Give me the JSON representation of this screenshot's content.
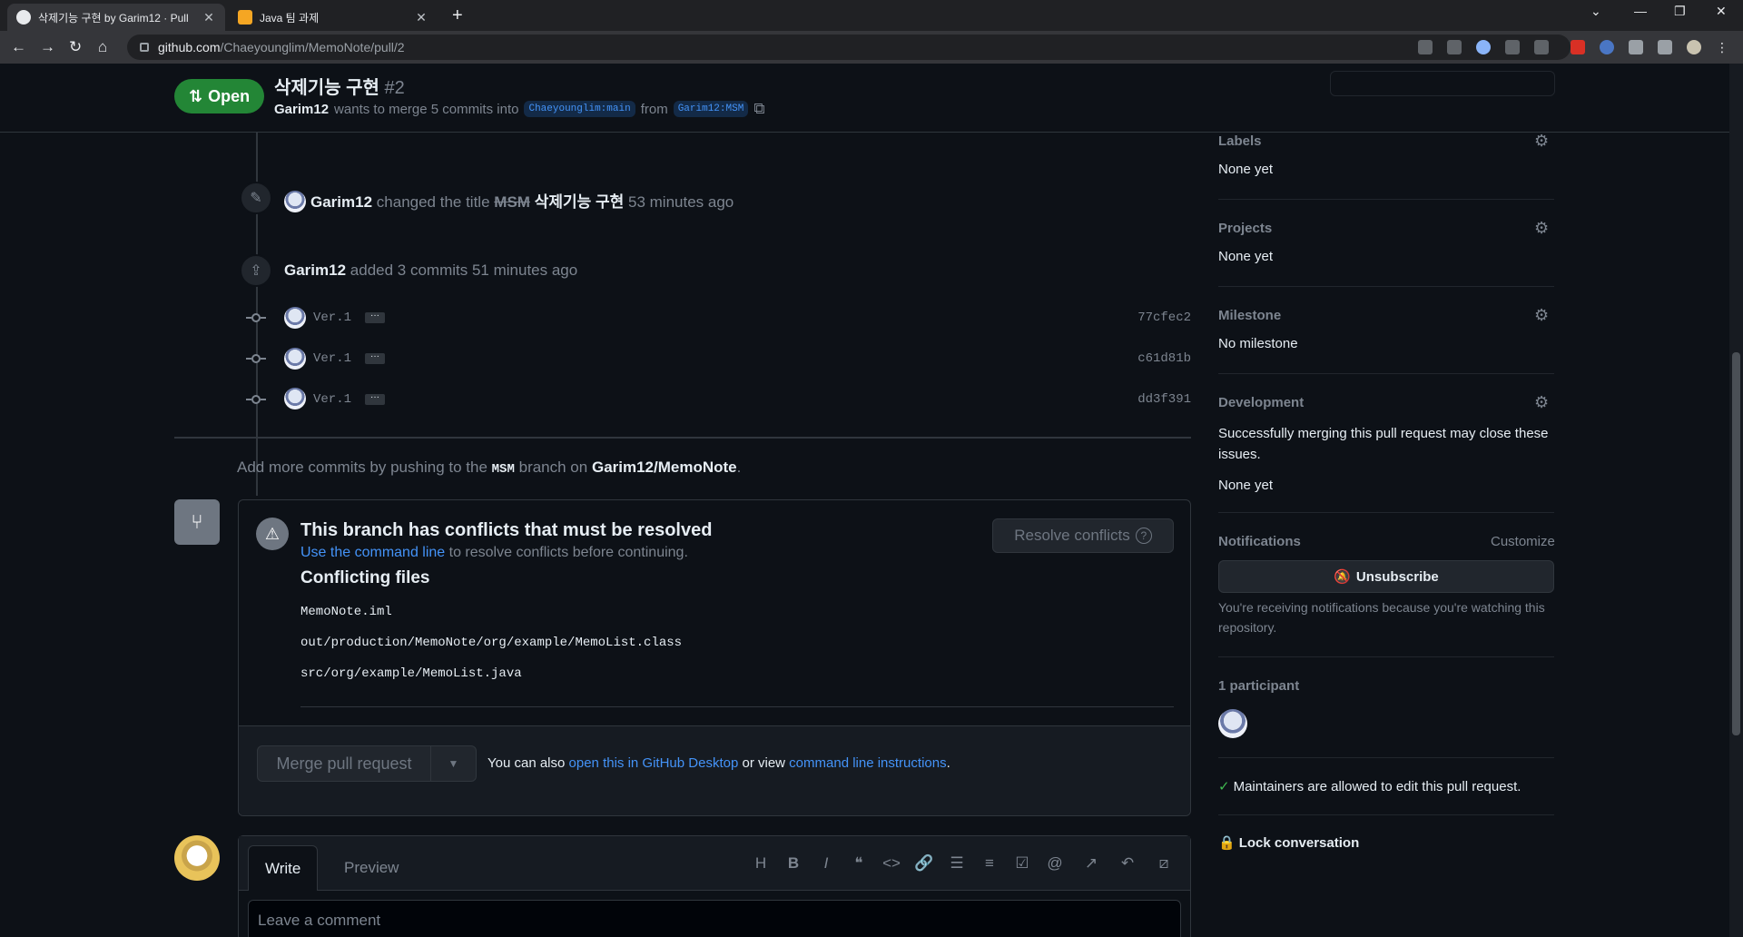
{
  "browser": {
    "tabs": [
      {
        "label": "삭제기능 구현 by Garim12 · Pull"
      },
      {
        "label": "Java 팀 과제"
      }
    ],
    "url_host": "github.com",
    "url_path": "/Chaeyounglim/MemoNote/pull/2"
  },
  "pr": {
    "state": "Open",
    "title": "삭제기능 구현",
    "number": "#2",
    "author": "Garim12",
    "merge_text": "wants to merge 5 commits into",
    "base_branch": "Chaeyounglim:main",
    "from_text": "from",
    "head_branch": "Garim12:MSM"
  },
  "timeline": {
    "rename": {
      "user": "Garim12",
      "action": "changed the title",
      "old": "MSM",
      "new": "삭제기능 구현",
      "time": "53 minutes ago"
    },
    "added": {
      "user": "Garim12",
      "action": "added 3 commits",
      "time": "51 minutes ago"
    },
    "commits": [
      {
        "msg": "Ver.1",
        "sha": "77cfec2"
      },
      {
        "msg": "Ver.1",
        "sha": "c61d81b"
      },
      {
        "msg": "Ver.1",
        "sha": "dd3f391"
      }
    ],
    "add_more_prefix": "Add more commits by pushing to the",
    "add_more_branch": "MSM",
    "add_more_mid": "branch on",
    "add_more_repo": "Garim12/MemoNote",
    "add_more_suffix": "."
  },
  "merge": {
    "conflict_title": "This branch has conflicts that must be resolved",
    "conflict_link": "Use the command line",
    "conflict_rest": "to resolve conflicts before continuing.",
    "resolve_label": "Resolve conflicts",
    "files_title": "Conflicting files",
    "files": [
      "MemoNote.iml",
      "out/production/MemoNote/org/example/MemoList.class",
      "src/org/example/MemoList.java"
    ],
    "merge_label": "Merge pull request",
    "also_prefix": "You can also",
    "desktop_link": "open this in GitHub Desktop",
    "or_view": "or view",
    "cli_link": "command line instructions",
    "period": "."
  },
  "comment": {
    "write_tab": "Write",
    "preview_tab": "Preview",
    "placeholder": "Leave a comment"
  },
  "sidebar": {
    "labels_h": "Labels",
    "labels_v": "None yet",
    "projects_h": "Projects",
    "projects_v": "None yet",
    "milestone_h": "Milestone",
    "milestone_v": "No milestone",
    "development_h": "Development",
    "development_note": "Successfully merging this pull request may close these issues.",
    "development_v": "None yet",
    "notifications_h": "Notifications",
    "customize": "Customize",
    "unsubscribe": "Unsubscribe",
    "notif_note": "You're receiving notifications because you're watching this repository.",
    "participants_h": "1 participant",
    "maintainers": "Maintainers are allowed to edit this pull request.",
    "lock": "Lock conversation"
  },
  "colors": {
    "open_green": "#238636",
    "link_blue": "#4493f8",
    "bg": "#0d1117"
  }
}
